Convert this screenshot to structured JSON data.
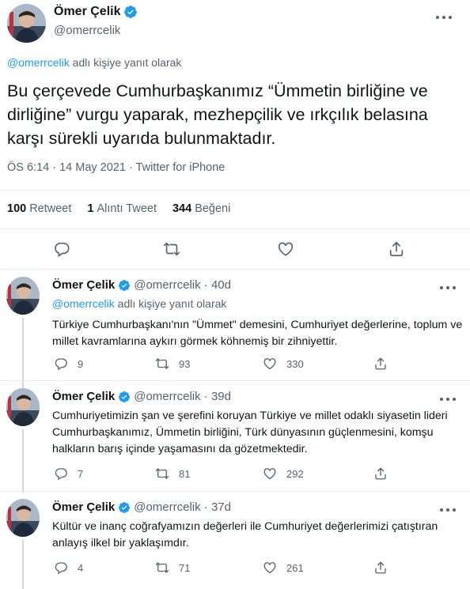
{
  "main_tweet": {
    "author_name": "Ömer Çelik",
    "handle": "@omerrcelik",
    "reply_prefix_mention": "@omerrcelik",
    "reply_suffix": "adlı kişiye yanıt olarak",
    "text": "Bu çerçevede Cumhurbaşkanımız “Ümmetin birliğine ve dirliğine” vurgu yaparak, mezhepçilik ve ırkçılık belasına karşı sürekli uyarıda bulunmaktadır.",
    "meta": "ÖS 6:14 · 14 May 2021 · Twitter for iPhone",
    "stats": {
      "retweets_count": "100",
      "retweets_label": "Retweet",
      "quotes_count": "1",
      "quotes_label": "Alıntı Tweet",
      "likes_count": "344",
      "likes_label": "Beğeni"
    }
  },
  "replies": [
    {
      "author_name": "Ömer Çelik",
      "handle_time": "@omerrcelik · 40d",
      "reply_prefix_mention": "@omerrcelik",
      "reply_suffix": "adlı kişiye yanıt olarak",
      "text": "Türkiye Cumhurbaşkanı'nın \"Ümmet\" demesini, Cumhuriyet değerlerine, toplum ve millet kavramlarına aykırı görmek köhnemiş bir zihniyettir.",
      "replies": "9",
      "retweets": "93",
      "likes": "330"
    },
    {
      "author_name": "Ömer Çelik",
      "handle_time": "@omerrcelik · 39d",
      "text": "Cumhuriyetimizin şan ve şerefini koruyan Türkiye ve millet odaklı siyasetin lideri Cumhurbaşkanımız, Ümmetin birliğini, Türk dünyasının güçlenmesini, komşu halkların barış içinde yaşamasını da gözetmektedir.",
      "replies": "7",
      "retweets": "81",
      "likes": "292"
    },
    {
      "author_name": "Ömer Çelik",
      "handle_time": "@omerrcelik · 37d",
      "text": "Kültür ve inanç coğrafyamızın değerleri ile Cumhuriyet değerlerimizi çatıştıran anlayış ilkel bir yaklaşımdır.",
      "replies": "4",
      "retweets": "71",
      "likes": "261"
    }
  ],
  "icons": {
    "verified": "verified-badge-icon",
    "reply": "reply-icon",
    "retweet": "retweet-icon",
    "like": "heart-icon",
    "share": "share-icon",
    "more": "more-icon"
  },
  "colors": {
    "accent": "#1d9bf0",
    "text": "#0f1419",
    "secondary": "#536471",
    "divider": "#e6ecf0"
  }
}
